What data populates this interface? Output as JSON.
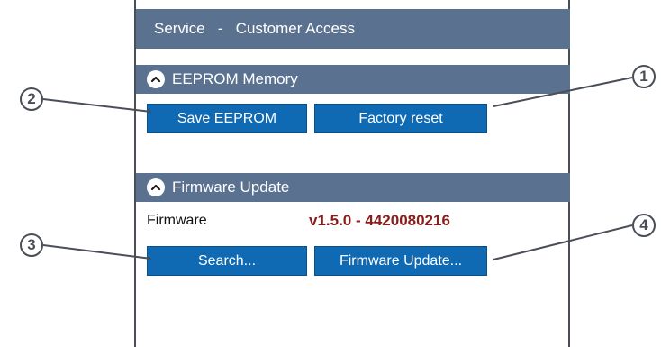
{
  "title_bar": {
    "label": "Service   -   Customer Access"
  },
  "eeprom": {
    "header": "EEPROM Memory",
    "save_label": "Save EEPROM",
    "reset_label": "Factory reset"
  },
  "firmware": {
    "header": "Firmware Update",
    "label": "Firmware",
    "version": "v1.5.0  -  4420080216",
    "search_label": "Search...",
    "update_label": "Firmware Update..."
  },
  "callouts": [
    "1",
    "2",
    "3",
    "4"
  ],
  "colors": {
    "header_bg": "#5a7190",
    "button_bg": "#0f6ab3",
    "version_text": "#8b1c1c"
  },
  "icons": {
    "section_toggle": "chevron-up-icon"
  }
}
